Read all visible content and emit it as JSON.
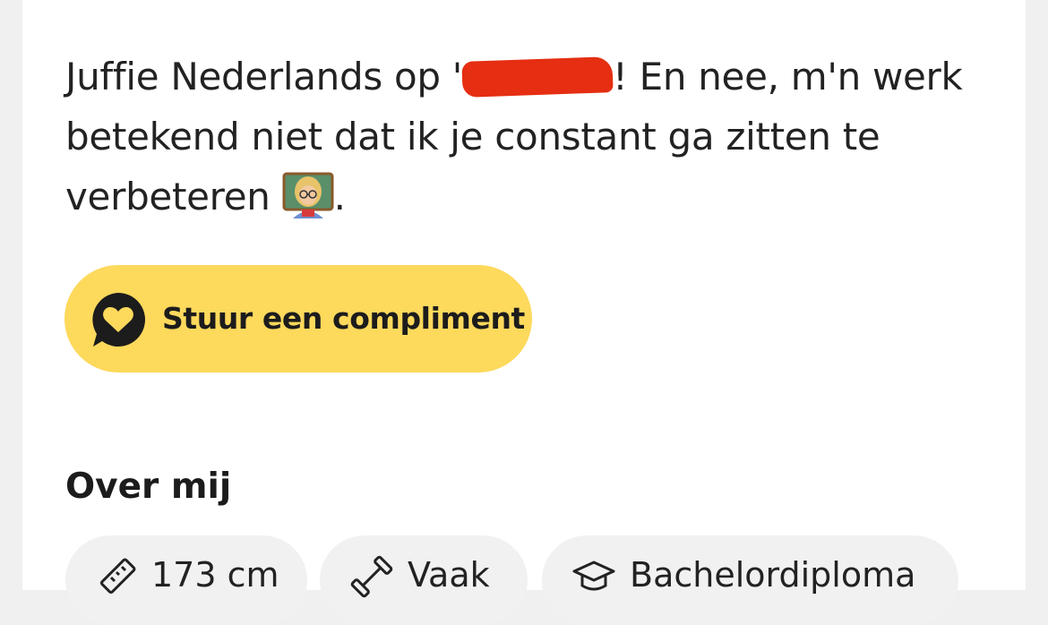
{
  "bio": {
    "part1": "Juffie Nederlands op '",
    "part2": "! En nee, m'n werk betekend niet dat ik je constant ga zitten te verbeteren ",
    "part3": ".",
    "emoji_name": "teacher-emoji"
  },
  "compliment_button": {
    "label": "Stuur een compliment",
    "icon": "chat-heart-icon"
  },
  "about": {
    "title": "Over mij",
    "chips": [
      {
        "label": "173 cm",
        "icon": "ruler-icon"
      },
      {
        "label": "Vaak",
        "icon": "dumbbell-icon"
      },
      {
        "label": "Bachelordiploma",
        "icon": "graduation-cap-icon"
      }
    ]
  },
  "colors": {
    "button_bg": "#fdd95c",
    "redaction": "#e52e12",
    "chip_bg": "#f1f1f1"
  }
}
